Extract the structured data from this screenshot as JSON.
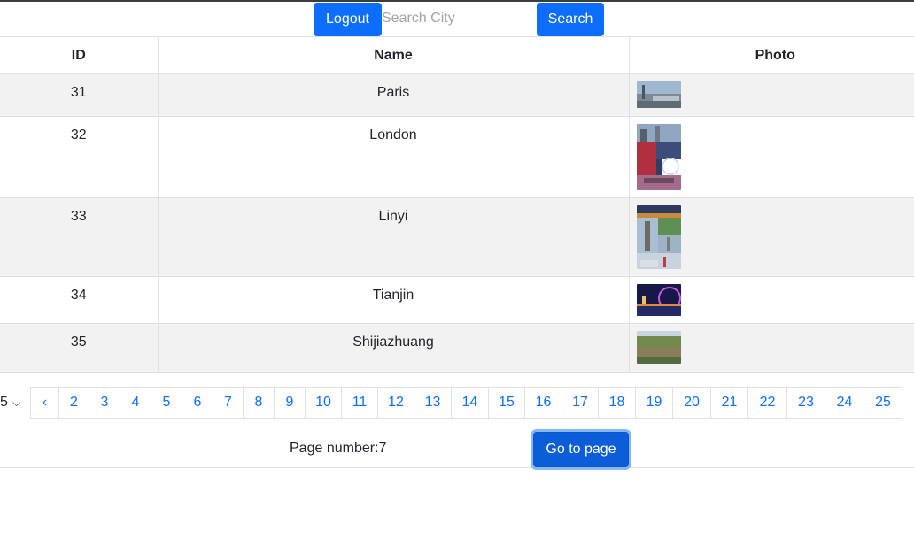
{
  "header": {
    "logout_label": "Logout",
    "search_placeholder": "Search City",
    "search_value": "",
    "search_label": "Search"
  },
  "table": {
    "columns": [
      "ID",
      "Name",
      "Photo"
    ],
    "rows": [
      {
        "id": "31",
        "name": "Paris"
      },
      {
        "id": "32",
        "name": "London"
      },
      {
        "id": "33",
        "name": "Linyi"
      },
      {
        "id": "34",
        "name": "Tianjin"
      },
      {
        "id": "35",
        "name": "Shijiazhuang"
      }
    ]
  },
  "pagination": {
    "page_size": "5",
    "prev": "‹",
    "pages": [
      "2",
      "3",
      "4",
      "5",
      "6",
      "7",
      "8",
      "9",
      "10",
      "11",
      "12",
      "13",
      "14",
      "15",
      "16",
      "17",
      "18",
      "19",
      "20",
      "21",
      "22",
      "23",
      "24",
      "25"
    ]
  },
  "footer": {
    "page_number_label": "Page number:7",
    "goto_label": "Go to page"
  },
  "colors": {
    "primary": "#0d6efd",
    "stripe": "#f2f2f2",
    "link": "#0d6efd"
  }
}
